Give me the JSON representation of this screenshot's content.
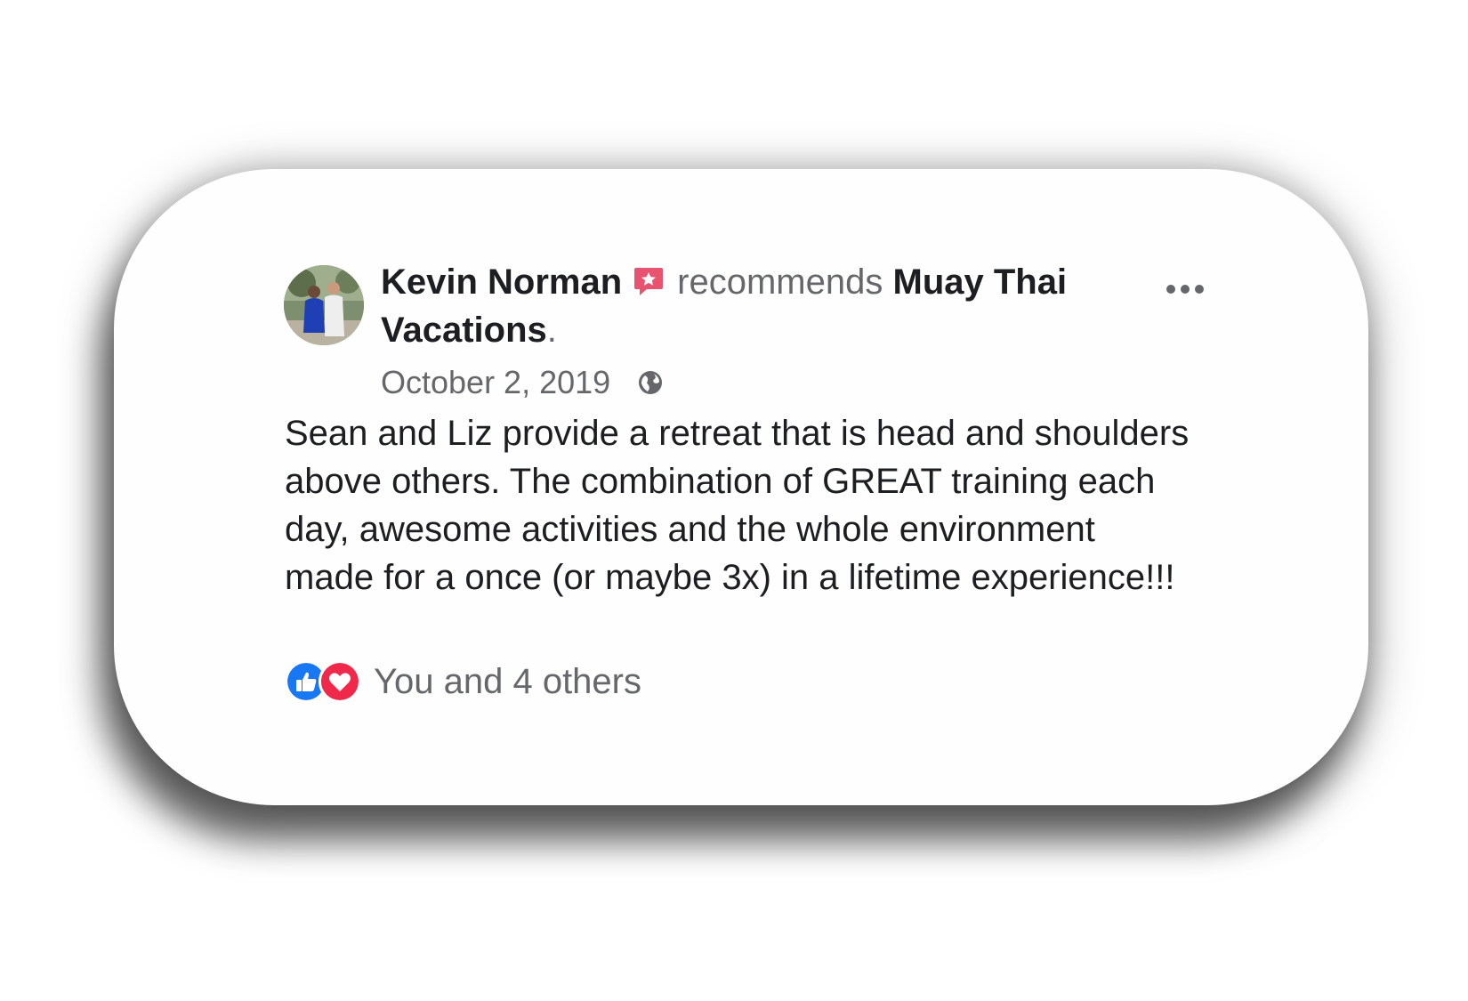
{
  "post": {
    "author_name": "Kevin Norman",
    "recommends_text": "recommends",
    "page_name": "Muay Thai Vacations",
    "period": ".",
    "date": "October 2, 2019",
    "body": "Sean and Liz provide a retreat that is head and shoulders above others.  The combination of GREAT training each day, awesome activities and the whole environment made for a once (or maybe 3x) in a lifetime experience!!!",
    "reactions_text": "You and 4 others"
  },
  "icons": {
    "recommend_badge": "recommend-star-icon",
    "audience": "globe-icon",
    "menu": "more-options-icon",
    "like": "like-icon",
    "love": "love-icon"
  },
  "colors": {
    "primary_text": "#1c1e21",
    "secondary_text": "#65676b",
    "like_blue": "#1877f2",
    "love_red": "#f02849",
    "badge_pink": "#e8546f"
  }
}
